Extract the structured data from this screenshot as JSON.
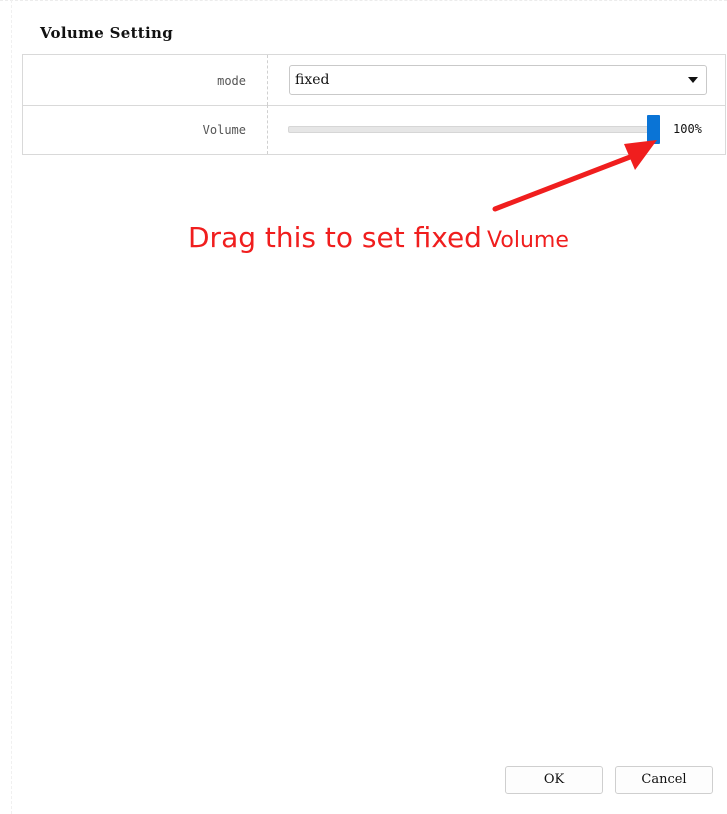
{
  "dialog": {
    "title": "Volume Setting"
  },
  "settings": {
    "mode": {
      "label": "mode",
      "selected": "fixed",
      "icon": "chevron-down-icon"
    },
    "volume": {
      "label": "Volume",
      "value_percent": 100,
      "value_text": "100%",
      "thumb_color": "#0a74d6"
    }
  },
  "annotation": {
    "text_part1": "Drag this to set fixed",
    "text_part2": "Volume",
    "color": "#f01e1e"
  },
  "buttons": {
    "ok_label": "OK",
    "cancel_label": "Cancel"
  }
}
